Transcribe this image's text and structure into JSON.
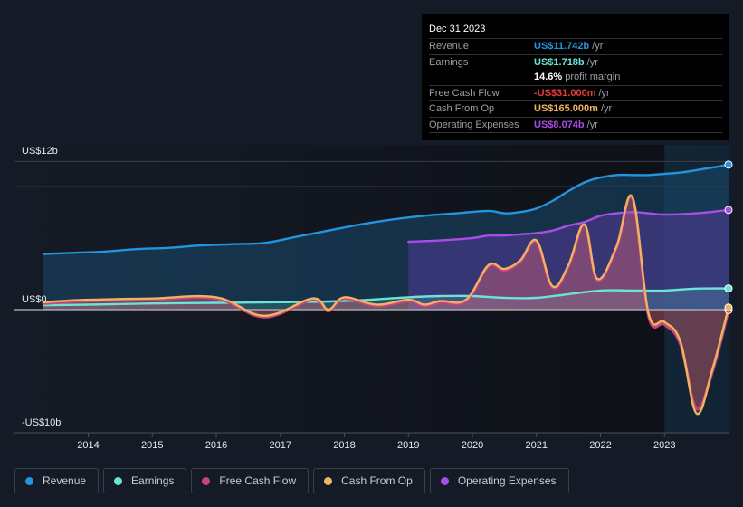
{
  "tooltip": {
    "date": "Dec 31 2023",
    "rows": [
      {
        "label": "Revenue",
        "value": "US$11.742b",
        "unit": "/yr",
        "color": "#2394df"
      },
      {
        "label": "Earnings",
        "value": "US$1.718b",
        "unit": "/yr",
        "color": "#6ce3d6"
      },
      {
        "label": "",
        "value": "14.6%",
        "unit": "profit margin",
        "color": "#ffffff"
      },
      {
        "label": "Free Cash Flow",
        "value": "-US$31.000m",
        "unit": "/yr",
        "color": "#ea3a3a"
      },
      {
        "label": "Cash From Op",
        "value": "US$165.000m",
        "unit": "/yr",
        "color": "#eeb45f"
      },
      {
        "label": "Operating Expenses",
        "value": "US$8.074b",
        "unit": "/yr",
        "color": "#a94de6"
      }
    ]
  },
  "legend": [
    {
      "label": "Revenue",
      "color": "#2394df"
    },
    {
      "label": "Earnings",
      "color": "#6ce3d6"
    },
    {
      "label": "Free Cash Flow",
      "color": "#c9437f"
    },
    {
      "label": "Cash From Op",
      "color": "#eeb45f"
    },
    {
      "label": "Operating Expenses",
      "color": "#a94de6"
    }
  ],
  "chart_data": {
    "type": "area",
    "title": "",
    "xlabel": "",
    "ylabel": "",
    "y_tick_labels": [
      "US$12b",
      "US$0",
      "-US$10b"
    ],
    "y_ticks": [
      12,
      0,
      -10
    ],
    "ylim": [
      -10,
      12
    ],
    "xlim": [
      2013.3,
      2024.0
    ],
    "x_tick_labels": [
      "2014",
      "2015",
      "2016",
      "2017",
      "2018",
      "2019",
      "2020",
      "2021",
      "2022",
      "2023"
    ],
    "x_ticks": [
      2014,
      2015,
      2016,
      2017,
      2018,
      2019,
      2020,
      2021,
      2022,
      2023
    ],
    "grid": true,
    "highlight_range": [
      2023.0,
      2024.0
    ],
    "legend_position": "bottom",
    "units": "US$ billions",
    "series": [
      {
        "name": "Revenue",
        "color": "#2394df",
        "x": [
          2013.3,
          2013.75,
          2014.25,
          2014.75,
          2015.25,
          2015.75,
          2016.25,
          2016.75,
          2017.25,
          2017.75,
          2018.25,
          2018.75,
          2019.25,
          2019.75,
          2020.25,
          2020.5,
          2020.75,
          2021.0,
          2021.25,
          2021.5,
          2021.75,
          2022.0,
          2022.25,
          2022.5,
          2022.75,
          2023.0,
          2023.25,
          2023.5,
          2023.75,
          2024.0
        ],
        "values": [
          4.5,
          4.6,
          4.7,
          4.9,
          5.0,
          5.2,
          5.3,
          5.4,
          5.9,
          6.4,
          6.9,
          7.3,
          7.6,
          7.8,
          8.0,
          7.8,
          7.9,
          8.2,
          8.8,
          9.6,
          10.3,
          10.7,
          10.9,
          10.9,
          10.9,
          11.0,
          11.1,
          11.3,
          11.5,
          11.742
        ]
      },
      {
        "name": "Earnings",
        "color": "#6ce3d6",
        "x": [
          2013.3,
          2014.0,
          2015.0,
          2016.0,
          2017.0,
          2018.0,
          2019.0,
          2019.5,
          2020.0,
          2020.5,
          2021.0,
          2021.5,
          2022.0,
          2022.5,
          2023.0,
          2023.5,
          2024.0
        ],
        "values": [
          0.35,
          0.4,
          0.5,
          0.55,
          0.6,
          0.7,
          1.0,
          1.1,
          1.1,
          0.95,
          0.95,
          1.25,
          1.55,
          1.55,
          1.55,
          1.7,
          1.718
        ]
      },
      {
        "name": "Free Cash Flow",
        "color": "#c9437f",
        "x": [
          2013.3,
          2014.0,
          2015.0,
          2016.0,
          2016.75,
          2017.5,
          2017.75,
          2018.0,
          2018.5,
          2019.0,
          2019.25,
          2019.5,
          2019.9,
          2020.25,
          2020.5,
          2020.75,
          2021.0,
          2021.25,
          2021.5,
          2021.75,
          2021.95,
          2022.25,
          2022.5,
          2022.75,
          2023.0,
          2023.25,
          2023.5,
          2023.75,
          2024.0
        ],
        "values": [
          0.5,
          0.7,
          0.8,
          0.9,
          -0.6,
          0.8,
          -0.1,
          0.9,
          0.3,
          0.7,
          0.3,
          0.6,
          0.7,
          3.5,
          3.2,
          3.9,
          5.5,
          1.8,
          3.5,
          6.8,
          2.4,
          5.0,
          9.0,
          -0.5,
          -1.2,
          -2.8,
          -8.0,
          -5.0,
          -0.031
        ]
      },
      {
        "name": "Cash From Op",
        "color": "#eeb45f",
        "x": [
          2013.3,
          2014.0,
          2015.0,
          2016.0,
          2016.75,
          2017.5,
          2017.75,
          2018.0,
          2018.5,
          2019.0,
          2019.25,
          2019.5,
          2019.9,
          2020.25,
          2020.5,
          2020.75,
          2021.0,
          2021.25,
          2021.5,
          2021.75,
          2021.95,
          2022.25,
          2022.5,
          2022.75,
          2023.0,
          2023.25,
          2023.5,
          2023.75,
          2024.0
        ],
        "values": [
          0.6,
          0.8,
          0.9,
          1.0,
          -0.5,
          0.9,
          0.0,
          1.0,
          0.4,
          0.8,
          0.4,
          0.7,
          0.8,
          3.6,
          3.3,
          4.0,
          5.6,
          1.9,
          3.6,
          6.9,
          2.5,
          5.1,
          9.1,
          -0.3,
          -1.0,
          -2.6,
          -8.4,
          -4.8,
          0.165
        ]
      },
      {
        "name": "Operating Expenses",
        "color": "#a94de6",
        "x": [
          2019.0,
          2019.5,
          2020.0,
          2020.25,
          2020.5,
          2020.75,
          2021.0,
          2021.25,
          2021.5,
          2021.75,
          2022.0,
          2022.25,
          2022.5,
          2022.75,
          2023.0,
          2023.5,
          2024.0
        ],
        "values": [
          5.5,
          5.6,
          5.8,
          6.0,
          6.0,
          6.1,
          6.2,
          6.4,
          6.8,
          7.1,
          7.6,
          7.8,
          7.9,
          7.8,
          7.7,
          7.8,
          8.074
        ]
      }
    ]
  }
}
